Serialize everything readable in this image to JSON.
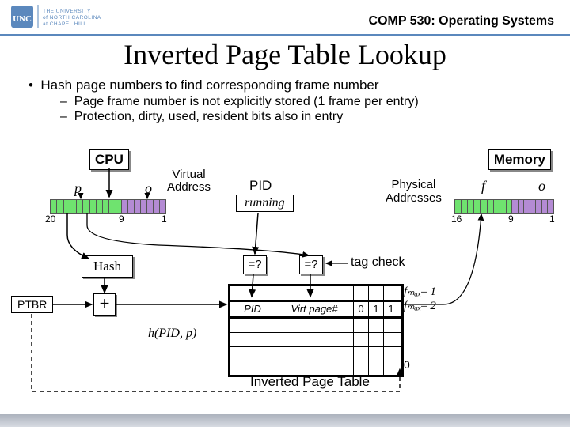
{
  "header": {
    "course": "COMP 530: Operating Systems"
  },
  "title": "Inverted Page Table Lookup",
  "bullets": {
    "b1": "Hash page numbers to find corresponding frame number",
    "b2a": "Page frame number is not explicitly stored (1 frame per entry)",
    "b2b": "Protection, dirty, used, resident bits also in entry"
  },
  "cpu": "CPU",
  "memory": "Memory",
  "va": {
    "p": "p",
    "o": "o",
    "caption": "Virtual\nAddress",
    "t20": "20",
    "t9": "9",
    "t1": "1"
  },
  "pa": {
    "f": "f",
    "o": "o",
    "caption": "Physical\nAddresses",
    "t16": "16",
    "t9": "9",
    "t1": "1"
  },
  "pid": "PID",
  "running": "running",
  "hash": "Hash",
  "ptbr": "PTBR",
  "plus": "+",
  "eq": "=?",
  "tagcheck": "tag check",
  "hfunc": "h(PID, p)",
  "table": {
    "caption": "Inverted Page Table",
    "pid": "PID",
    "vpn": "Virt page#",
    "bits": "0 1 1",
    "fmax1": "fₘₐₓ– 1",
    "fmax2": "fₘₐₓ– 2",
    "zero": "0"
  }
}
